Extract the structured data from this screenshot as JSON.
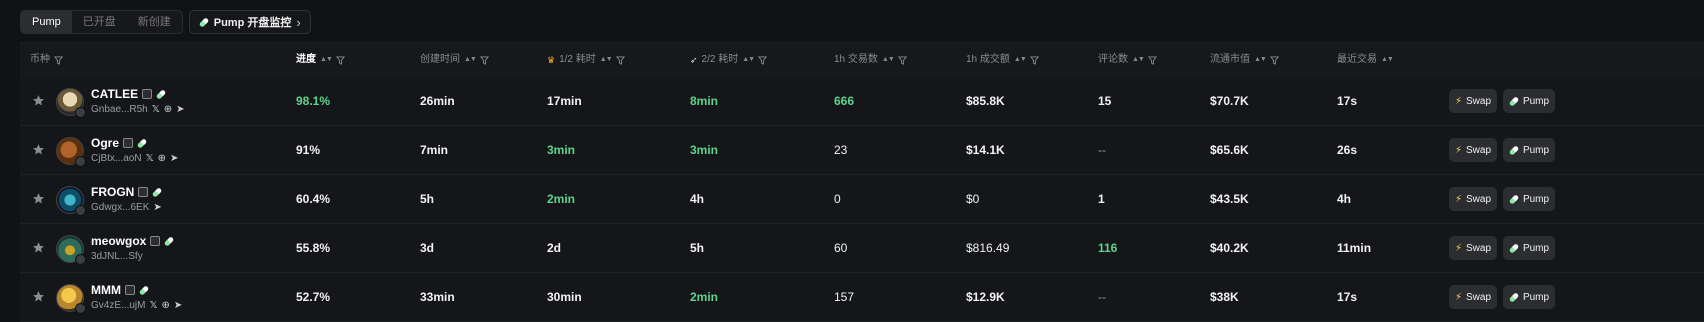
{
  "tabs": [
    "Pump",
    "已开盘",
    "新创建"
  ],
  "monitor_label": "Pump 开盘监控",
  "columns": {
    "token": "币种",
    "progress": "进度",
    "created": "创建时间",
    "half1": "1/2 耗时",
    "half2": "2/2 耗时",
    "tx1h": "1h 交易数",
    "vol1h": "1h 成交额",
    "comments": "评论数",
    "mcap": "流通市值",
    "recent": "最近交易"
  },
  "buttons": {
    "swap": "Swap",
    "pump": "Pump"
  },
  "colors": {
    "accent_green": "#5fd38d",
    "crown": "#f0b429",
    "bolt": "#ffd34d"
  },
  "rows": [
    {
      "name": "CATLEE",
      "addr": "Gnbae...R5h",
      "socials": "x web tg",
      "progress": "98.1%",
      "created": "26min",
      "half1": "17min",
      "half2": "8min",
      "tx1h": "666",
      "vol1h": "$85.8K",
      "comments": "15",
      "mcap": "$70.7K",
      "recent": "17s"
    },
    {
      "name": "Ogre",
      "addr": "CjBtx...aoN",
      "socials": "x web tg",
      "progress": "91%",
      "created": "7min",
      "half1": "3min",
      "half2": "3min",
      "tx1h": "23",
      "vol1h": "$14.1K",
      "comments": "--",
      "mcap": "$65.6K",
      "recent": "26s"
    },
    {
      "name": "FROGN",
      "addr": "Gdwgx...6EK",
      "socials": "tg",
      "progress": "60.4%",
      "created": "5h",
      "half1": "2min",
      "half2": "4h",
      "tx1h": "0",
      "vol1h": "$0",
      "comments": "1",
      "mcap": "$43.5K",
      "recent": "4h"
    },
    {
      "name": "meowgox",
      "addr": "3dJNL...Sfy",
      "socials": "",
      "progress": "55.8%",
      "created": "3d",
      "half1": "2d",
      "half2": "5h",
      "tx1h": "60",
      "vol1h": "$816.49",
      "comments": "116",
      "mcap": "$40.2K",
      "recent": "11min"
    },
    {
      "name": "MMM",
      "addr": "Gv4zE...ujM",
      "socials": "x web tg",
      "progress": "52.7%",
      "created": "33min",
      "half1": "30min",
      "half2": "2min",
      "tx1h": "157",
      "vol1h": "$12.9K",
      "comments": "--",
      "mcap": "$38K",
      "recent": "17s"
    }
  ]
}
